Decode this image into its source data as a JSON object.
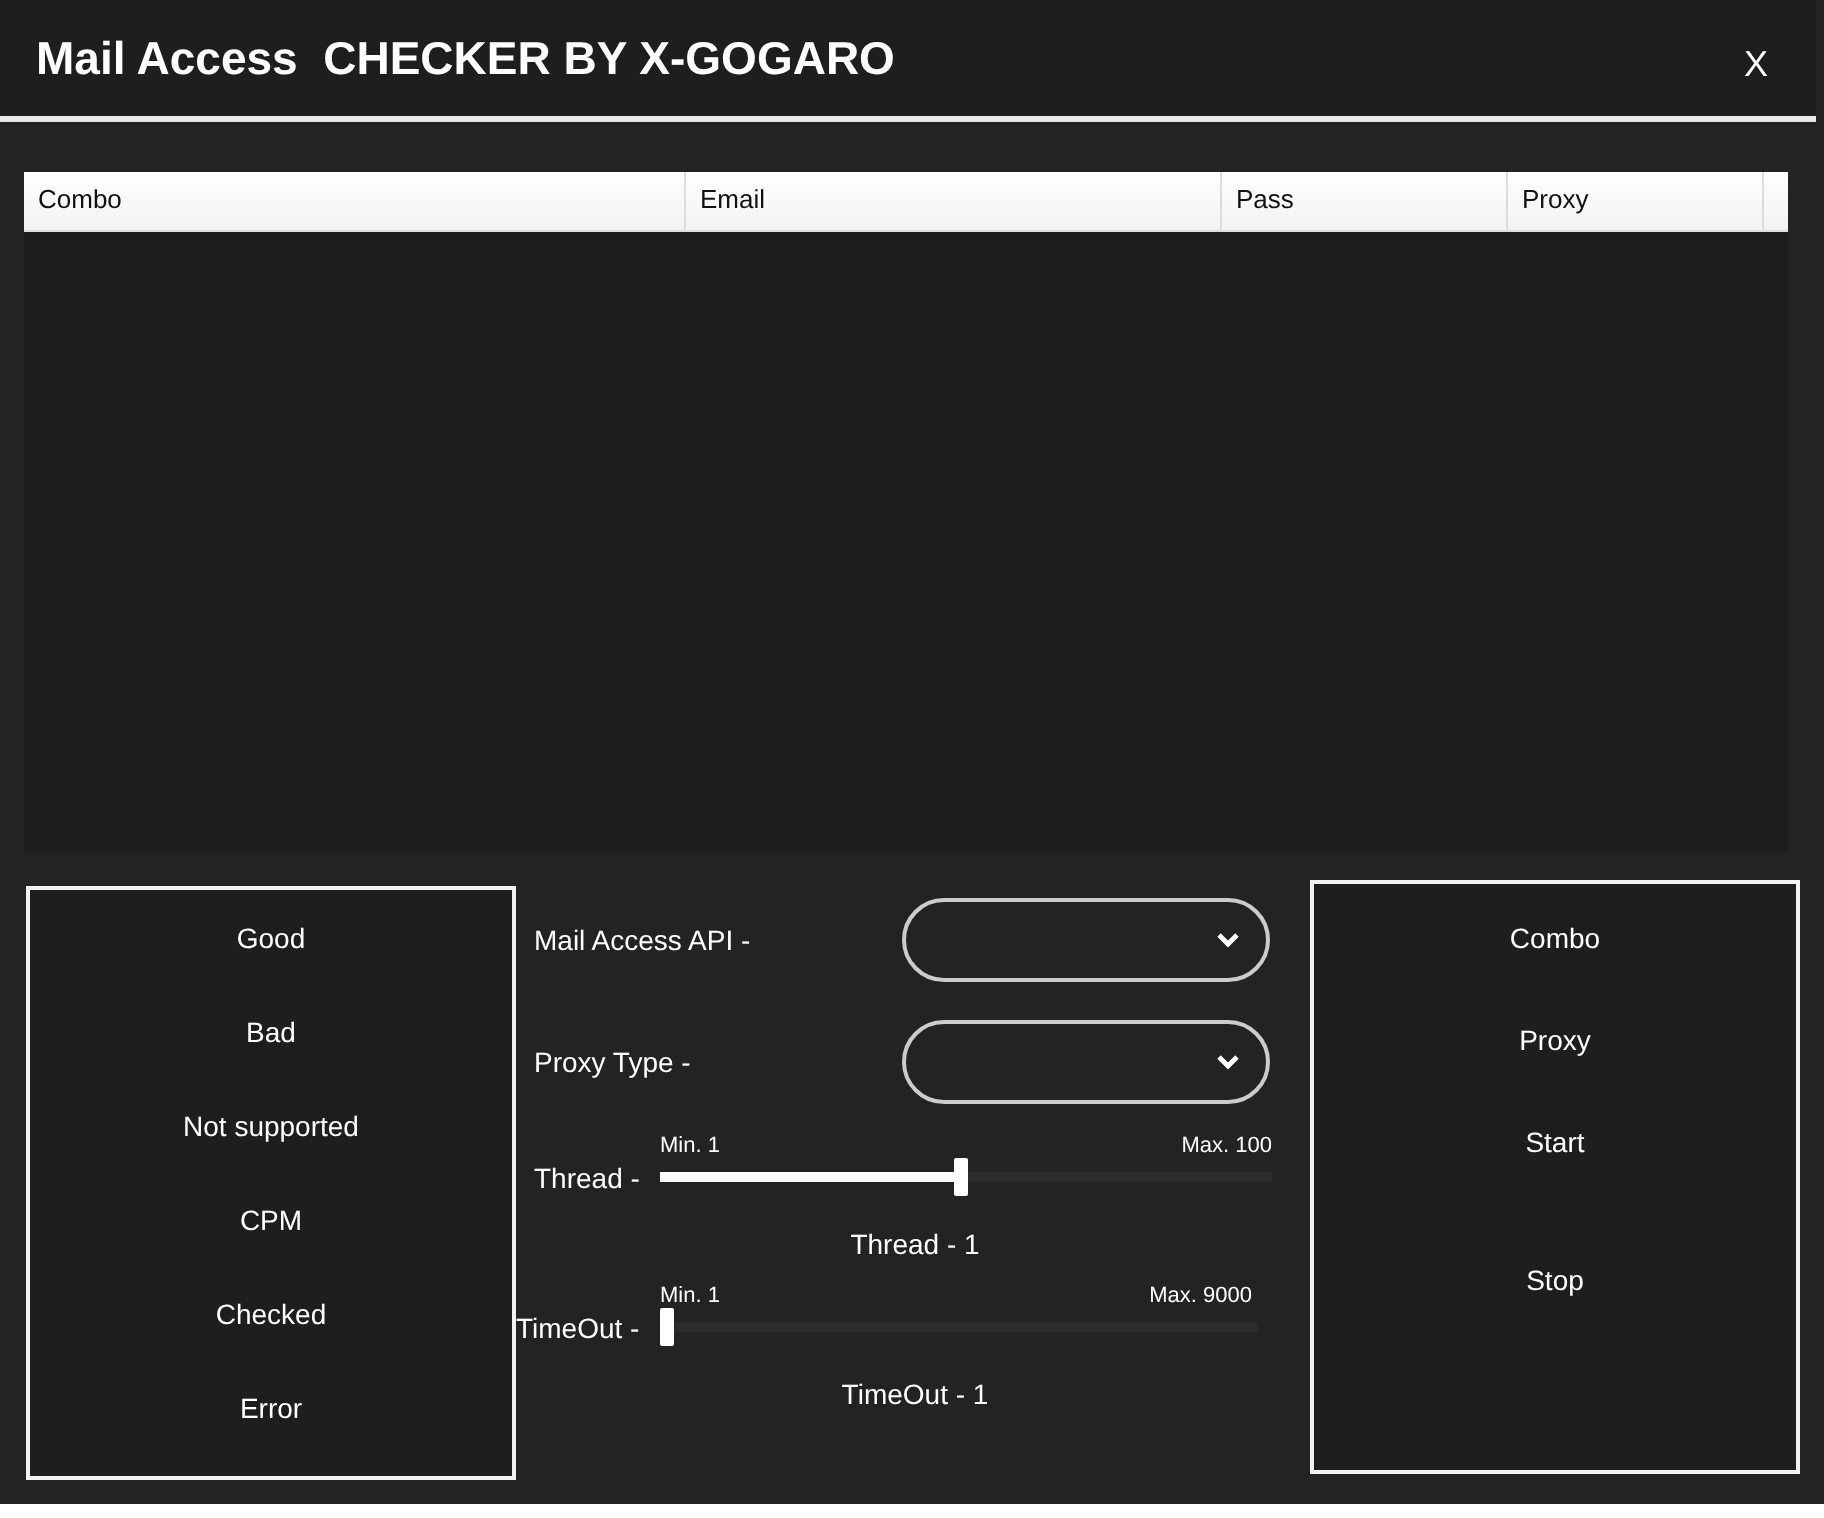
{
  "window": {
    "title": "Mail Access  CHECKER BY X-GOGARO",
    "close": "X"
  },
  "table": {
    "columns": [
      "Combo",
      "Email",
      "Pass",
      "Proxy"
    ]
  },
  "stats": [
    "Good",
    "Bad",
    "Not supported",
    "CPM",
    "Checked",
    "Error"
  ],
  "dropdowns": [
    {
      "label": "Mail Access API -"
    },
    {
      "label": "Proxy Type -"
    }
  ],
  "sliders": [
    {
      "label": "Thread -",
      "min": "Min. 1",
      "max": "Max. 100",
      "level": 0.49,
      "reading": "Thread - 1"
    },
    {
      "label": "TimeOut -",
      "min": "Min. 1",
      "max": "Max. 9000",
      "level": 0,
      "reading": "TimeOut - 1"
    }
  ],
  "buttons": [
    "Combo",
    "Proxy",
    "Start",
    "Stop"
  ]
}
